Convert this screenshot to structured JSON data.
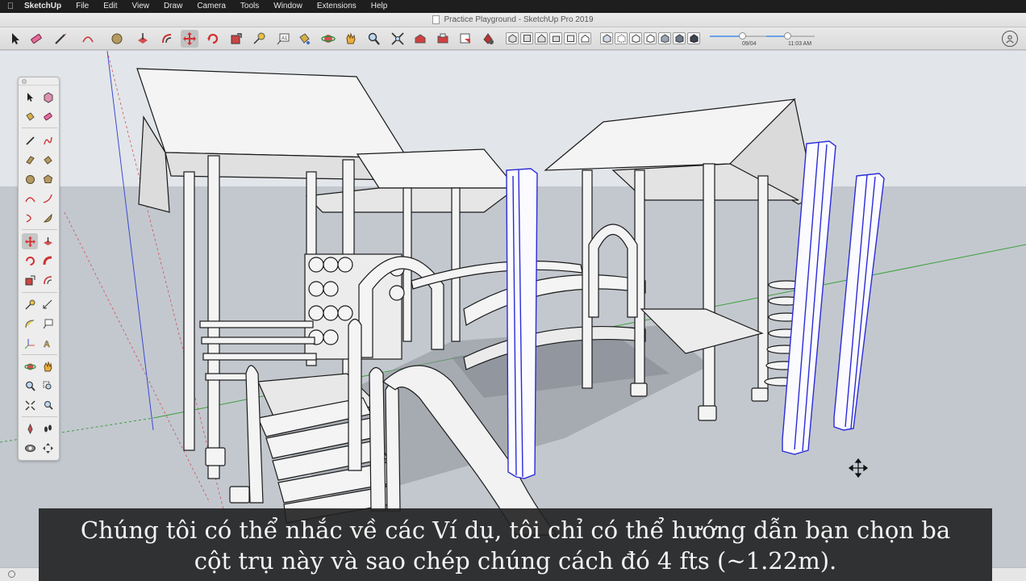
{
  "menubar": {
    "apple_symbol": "",
    "app_name": "SketchUp",
    "items": [
      "File",
      "Edit",
      "View",
      "Draw",
      "Camera",
      "Tools",
      "Window",
      "Extensions",
      "Help"
    ]
  },
  "window": {
    "title": "Practice Playground - SketchUp Pro 2019"
  },
  "toolbar": {
    "shadow_date": "09/04",
    "shadow_time": "11:03 AM"
  },
  "subtitle": {
    "line1": "Chúng tôi có thể nhắc về các Ví dụ, tôi chỉ có thể hướng dẫn bạn chọn ba",
    "line2": "cột trụ này và sao chép chúng cách đó 4 fts (~1.22m)."
  },
  "colors": {
    "sky": "#e2e6ea",
    "ground": "#c2c7ce",
    "selection": "#2b2bd8",
    "model_face": "#f4f4f4",
    "model_edge": "#1a1a1a",
    "axis_red": "#d25050",
    "axis_green": "#3aa03a",
    "axis_blue": "#3a4ad0"
  },
  "icons": {
    "select": "arrow-select-icon",
    "eraser": "eraser-icon",
    "line": "pencil-line-icon",
    "arc": "arc-icon",
    "shapes": "circle-shape-icon",
    "push_pull": "push-pull-icon",
    "offset": "offset-icon",
    "move": "move-icon",
    "rotate": "rotate-icon",
    "scale": "scale-icon",
    "tape": "tape-measure-icon",
    "text": "text-icon",
    "paint": "paint-bucket-icon",
    "orbit": "orbit-icon",
    "pan": "pan-icon",
    "zoom": "zoom-icon",
    "zoom_extents": "zoom-extents-icon",
    "user": "user-account-icon"
  }
}
